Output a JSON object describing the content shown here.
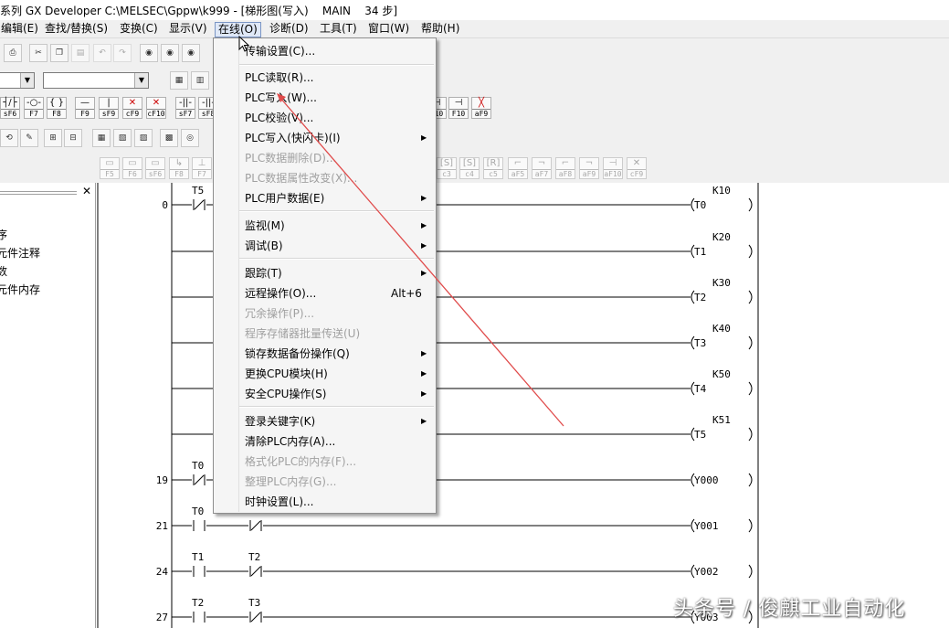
{
  "title": "系列 GX Developer C:\\MELSEC\\Gppw\\k999 - [梯形图(写入)    MAIN    34 步]",
  "menu": [
    {
      "label": "编辑(E)"
    },
    {
      "label": "查找/替换(S)"
    },
    {
      "label": "变换(C)"
    },
    {
      "label": "显示(V)"
    },
    {
      "label": "在线(O)"
    },
    {
      "label": "诊断(D)"
    },
    {
      "label": "工具(T)"
    },
    {
      "label": "窗口(W)"
    },
    {
      "label": "帮助(H)"
    }
  ],
  "online_menu": {
    "items": [
      {
        "label": "传输设置(C)...",
        "enabled": true
      },
      {
        "label": "PLC读取(R)...",
        "enabled": true
      },
      {
        "label": "PLC写入(W)...",
        "enabled": true
      },
      {
        "label": "PLC校验(V)...",
        "enabled": true
      },
      {
        "label": "PLC写入(快闪卡)(I)",
        "enabled": true
      },
      {
        "label": "PLC数据删除(D)...",
        "enabled": false
      },
      {
        "label": "PLC数据属性改变(X)...",
        "enabled": false
      },
      {
        "label": "PLC用户数据(E)",
        "enabled": true
      },
      {
        "label": "监视(M)",
        "enabled": true
      },
      {
        "label": "调试(B)",
        "enabled": true
      },
      {
        "label": "跟踪(T)",
        "enabled": true
      },
      {
        "label": "远程操作(O)...",
        "enabled": true,
        "shortcut": "Alt+6"
      },
      {
        "label": "冗余操作(P)...",
        "enabled": false
      },
      {
        "label": "程序存储器批量传送(U)",
        "enabled": false
      },
      {
        "label": "锁存数据备份操作(Q)",
        "enabled": true
      },
      {
        "label": "更换CPU模块(H)",
        "enabled": true
      },
      {
        "label": "安全CPU操作(S)",
        "enabled": true
      },
      {
        "label": "登录关键字(K)",
        "enabled": true
      },
      {
        "label": "清除PLC内存(A)...",
        "enabled": true
      },
      {
        "label": "格式化PLC的内存(F)...",
        "enabled": false
      },
      {
        "label": "整理PLC内存(G)...",
        "enabled": false
      },
      {
        "label": "时钟设置(L)...",
        "enabled": true
      }
    ]
  },
  "fkeys_row1": [
    {
      "sym": "┤/├",
      "lab": "sF6"
    },
    {
      "sym": "-○-",
      "lab": "F7"
    },
    {
      "sym": "{ }",
      "lab": "F8"
    },
    {
      "sym": "—",
      "lab": "F9"
    },
    {
      "sym": "|",
      "lab": "sF9"
    },
    {
      "sym": "✕",
      "lab": "cF9"
    },
    {
      "sym": "✕",
      "lab": "cF10"
    },
    {
      "sym": "-||-",
      "lab": "sF7"
    },
    {
      "sym": "-||-",
      "lab": "sF8"
    }
  ],
  "fkeys_row1_right": [
    {
      "sym": "⊣",
      "lab": "F10"
    },
    {
      "sym": "⊣",
      "lab": "F10"
    },
    {
      "sym": "╳",
      "lab": "aF9"
    }
  ],
  "fkeys_row4": [
    {
      "sym": "▭",
      "lab": "F5"
    },
    {
      "sym": "▭",
      "lab": "F6"
    },
    {
      "sym": "▭",
      "lab": "sF6"
    },
    {
      "sym": "↳",
      "lab": "F8"
    },
    {
      "sym": "⊥",
      "lab": "F7"
    }
  ],
  "fkeys_row4_right": [
    {
      "sym": "[S]",
      "lab": "c3"
    },
    {
      "sym": "[S]",
      "lab": "c4"
    },
    {
      "sym": "[R]",
      "lab": "c5"
    },
    {
      "sym": "⌐",
      "lab": "aF5"
    },
    {
      "sym": "¬",
      "lab": "aF7"
    },
    {
      "sym": "⌐",
      "lab": "aF8"
    },
    {
      "sym": "¬",
      "lab": "aF9"
    },
    {
      "sym": "⊣",
      "lab": "aF10"
    },
    {
      "sym": "✕",
      "lab": "cF9"
    }
  ],
  "project_tree": [
    "序",
    "元件注释",
    "数",
    "元件内存"
  ],
  "ladder": {
    "rungs": [
      {
        "step": "0",
        "contacts": [
          {
            "dev": "T5",
            "type": "NC"
          }
        ],
        "coil": "T0",
        "k": "K10"
      },
      {
        "step": "",
        "contacts": [],
        "coil": "T1",
        "k": "K20"
      },
      {
        "step": "",
        "contacts": [],
        "coil": "T2",
        "k": "K30"
      },
      {
        "step": "",
        "contacts": [],
        "coil": "T3",
        "k": "K40"
      },
      {
        "step": "",
        "contacts": [],
        "coil": "T4",
        "k": "K50"
      },
      {
        "step": "",
        "contacts": [],
        "coil": "T5",
        "k": "K51"
      },
      {
        "step": "19",
        "contacts": [
          {
            "dev": "T0",
            "type": "NC"
          }
        ],
        "coil": "Y000",
        "k": ""
      },
      {
        "step": "21",
        "contacts": [
          {
            "dev": "T0",
            "type": "NO"
          },
          {
            "dev": "",
            "type": "NC"
          }
        ],
        "coil": "Y001",
        "k": ""
      },
      {
        "step": "24",
        "contacts": [
          {
            "dev": "T1",
            "type": "NO"
          },
          {
            "dev": "T2",
            "type": "NC"
          }
        ],
        "coil": "Y002",
        "k": ""
      },
      {
        "step": "27",
        "contacts": [
          {
            "dev": "T2",
            "type": "NO"
          },
          {
            "dev": "T3",
            "type": "NC"
          }
        ],
        "coil": "Y003",
        "k": ""
      }
    ]
  },
  "watermark": "头条号 / 俊麒工业自动化",
  "colors": {
    "arrow": "#e04b4b",
    "menu_open_bg": "#dfe8f7",
    "menu_bg": "#f5f5f5",
    "disabled_text": "#a0a0a0"
  }
}
